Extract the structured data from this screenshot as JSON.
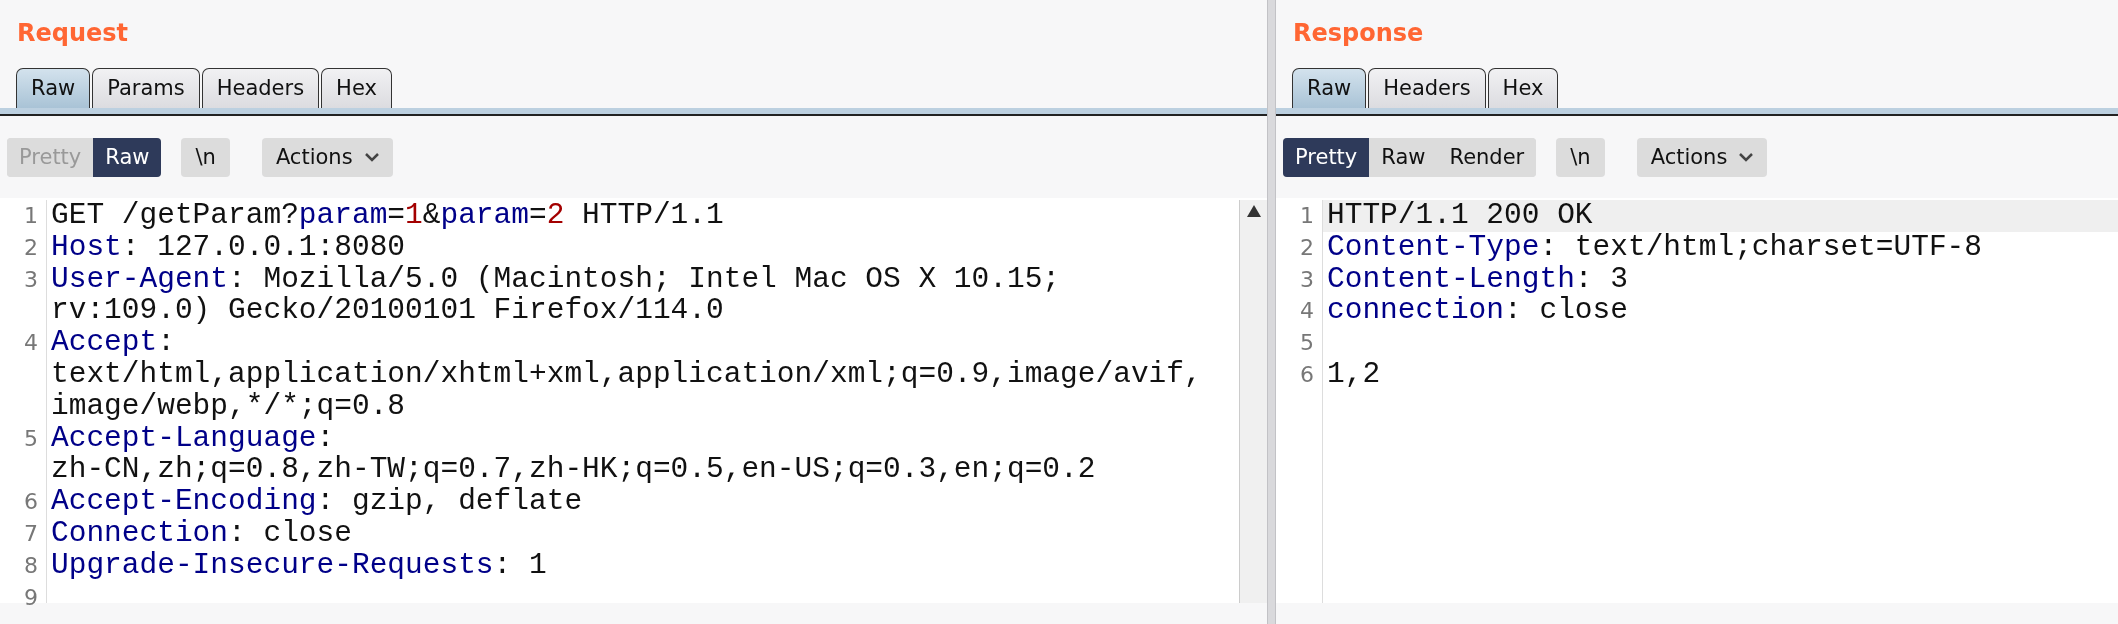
{
  "request": {
    "title": "Request",
    "tabs": [
      {
        "label": "Raw",
        "selected": true
      },
      {
        "label": "Params",
        "selected": false
      },
      {
        "label": "Headers",
        "selected": false
      },
      {
        "label": "Hex",
        "selected": false
      }
    ],
    "view_modes": [
      {
        "label": "Pretty",
        "selected": false,
        "disabled": true
      },
      {
        "label": "Raw",
        "selected": true,
        "disabled": false
      }
    ],
    "newline_button": "\\n",
    "actions_button": "Actions",
    "lines": [
      {
        "number": "1",
        "highlighted": false,
        "rows": [
          [
            {
              "text": "GET /getParam?",
              "kind": "plain"
            },
            {
              "text": "param",
              "kind": "name"
            },
            {
              "text": "=",
              "kind": "plain"
            },
            {
              "text": "1",
              "kind": "value"
            },
            {
              "text": "&",
              "kind": "plain"
            },
            {
              "text": "param",
              "kind": "name"
            },
            {
              "text": "=",
              "kind": "plain"
            },
            {
              "text": "2",
              "kind": "value"
            },
            {
              "text": " HTTP/1.1",
              "kind": "plain"
            }
          ]
        ]
      },
      {
        "number": "2",
        "highlighted": false,
        "rows": [
          [
            {
              "text": "Host",
              "kind": "name"
            },
            {
              "text": ": 127.0.0.1:8080",
              "kind": "plain"
            }
          ]
        ]
      },
      {
        "number": "3",
        "highlighted": false,
        "rows": [
          [
            {
              "text": "User-Agent",
              "kind": "name"
            },
            {
              "text": ": Mozilla/5.0 (Macintosh; Intel Mac OS X 10.15;",
              "kind": "plain"
            }
          ],
          [
            {
              "text": "rv:109.0) Gecko/20100101 Firefox/114.0",
              "kind": "plain"
            }
          ]
        ]
      },
      {
        "number": "4",
        "highlighted": false,
        "rows": [
          [
            {
              "text": "Accept",
              "kind": "name"
            },
            {
              "text": ":",
              "kind": "plain"
            }
          ],
          [
            {
              "text": "text/html,application/xhtml+xml,application/xml;q=0.9,image/avif,",
              "kind": "plain"
            }
          ],
          [
            {
              "text": "image/webp,*/*;q=0.8",
              "kind": "plain"
            }
          ]
        ]
      },
      {
        "number": "5",
        "highlighted": false,
        "rows": [
          [
            {
              "text": "Accept-Language",
              "kind": "name"
            },
            {
              "text": ":",
              "kind": "plain"
            }
          ],
          [
            {
              "text": "zh-CN,zh;q=0.8,zh-TW;q=0.7,zh-HK;q=0.5,en-US;q=0.3,en;q=0.2",
              "kind": "plain"
            }
          ]
        ]
      },
      {
        "number": "6",
        "highlighted": false,
        "rows": [
          [
            {
              "text": "Accept-Encoding",
              "kind": "name"
            },
            {
              "text": ": gzip, deflate",
              "kind": "plain"
            }
          ]
        ]
      },
      {
        "number": "7",
        "highlighted": false,
        "rows": [
          [
            {
              "text": "Connection",
              "kind": "name"
            },
            {
              "text": ": close",
              "kind": "plain"
            }
          ]
        ]
      },
      {
        "number": "8",
        "highlighted": false,
        "rows": [
          [
            {
              "text": "Upgrade-Insecure-Requests",
              "kind": "name"
            },
            {
              "text": ": 1",
              "kind": "plain"
            }
          ]
        ]
      },
      {
        "number": "9",
        "highlighted": false
      }
    ]
  },
  "response": {
    "title": "Response",
    "tabs": [
      {
        "label": "Raw",
        "selected": true
      },
      {
        "label": "Headers",
        "selected": false
      },
      {
        "label": "Hex",
        "selected": false
      }
    ],
    "view_modes": [
      {
        "label": "Pretty",
        "selected": true,
        "disabled": false
      },
      {
        "label": "Raw",
        "selected": false,
        "disabled": false
      },
      {
        "label": "Render",
        "selected": false,
        "disabled": false
      }
    ],
    "newline_button": "\\n",
    "actions_button": "Actions",
    "lines": [
      {
        "number": "1",
        "highlighted": true,
        "rows": [
          [
            {
              "text": "HTTP/1.1 200 OK",
              "kind": "plain"
            }
          ]
        ]
      },
      {
        "number": "2",
        "highlighted": false,
        "rows": [
          [
            {
              "text": "Content-Type",
              "kind": "name"
            },
            {
              "text": ": text/html;charset=UTF-8",
              "kind": "plain"
            }
          ]
        ]
      },
      {
        "number": "3",
        "highlighted": false,
        "rows": [
          [
            {
              "text": "Content-Length",
              "kind": "name"
            },
            {
              "text": ": 3",
              "kind": "plain"
            }
          ]
        ]
      },
      {
        "number": "4",
        "highlighted": false,
        "rows": [
          [
            {
              "text": "connection",
              "kind": "name"
            },
            {
              "text": ": close",
              "kind": "plain"
            }
          ]
        ]
      },
      {
        "number": "5",
        "highlighted": false
      },
      {
        "number": "6",
        "highlighted": false,
        "rows": [
          [
            {
              "text": "1,2",
              "kind": "plain"
            }
          ]
        ]
      }
    ]
  }
}
